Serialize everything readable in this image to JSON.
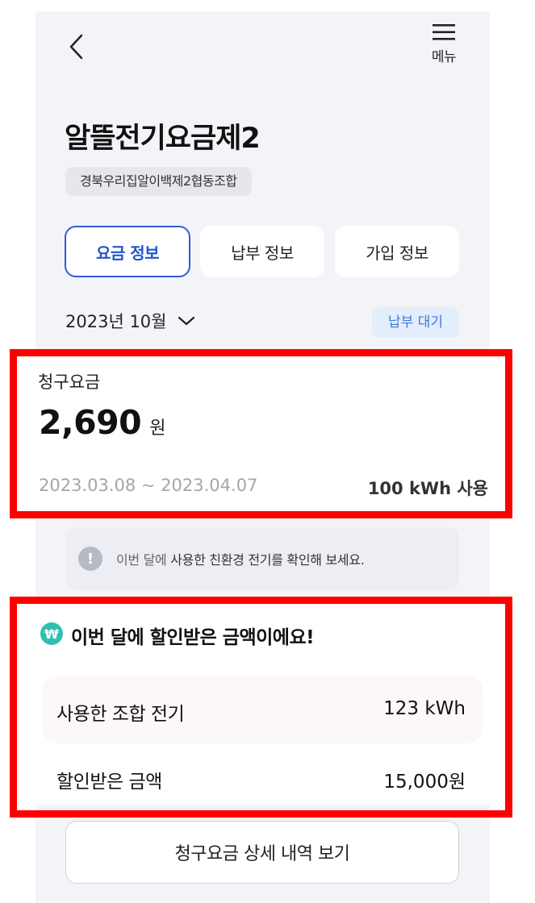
{
  "header": {
    "menu_label": "메뉴"
  },
  "plan": {
    "title": "알뜰전기요금제2",
    "coop_name": "경북우리집알이백제2협동조합"
  },
  "tabs": [
    {
      "label": "요금 정보",
      "active": true
    },
    {
      "label": "납부 정보",
      "active": false
    },
    {
      "label": "가입 정보",
      "active": false
    }
  ],
  "billing": {
    "month": "2023년 10월",
    "status": "납부 대기",
    "label": "청구요금",
    "amount": "2,690",
    "unit": "원",
    "period": "2023.03.08 ~ 2023.04.07",
    "usage": "100 kWh 사용"
  },
  "notice": {
    "prefix": "이번 달에",
    "text": "사용한 친환경 전기를 확인해 보세요."
  },
  "discount": {
    "icon_symbol": "₩",
    "title": "이번 달에 할인받은 금액이에요!",
    "rows": [
      {
        "label": "사용한 조합 전기",
        "value": "123 kWh"
      },
      {
        "label": "할인받은 금액",
        "value": "15,000원"
      }
    ]
  },
  "detail_button": {
    "label": "청구요금 상세 내역 보기"
  },
  "colors": {
    "accent": "#2d5fd6",
    "highlight_box": "#ff0000",
    "badge_text": "#3b7be0",
    "won_icon": "#2ec0b0"
  }
}
